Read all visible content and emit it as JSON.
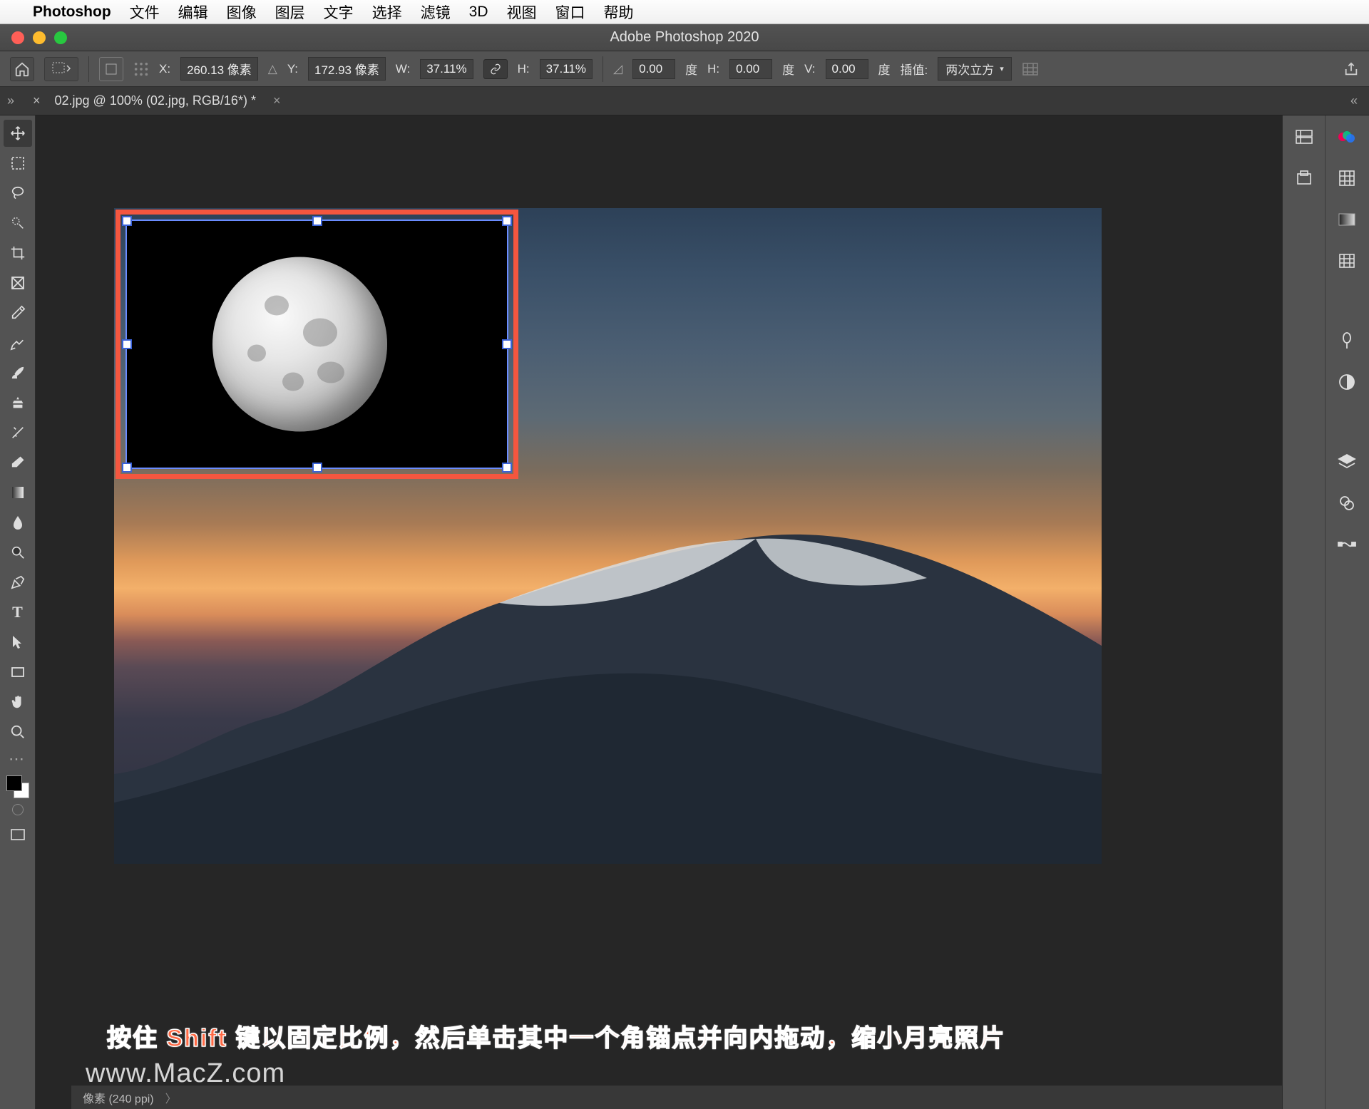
{
  "mac_menu": {
    "app": "Photoshop",
    "items": [
      "文件",
      "编辑",
      "图像",
      "图层",
      "文字",
      "选择",
      "滤镜",
      "3D",
      "视图",
      "窗口",
      "帮助"
    ]
  },
  "window": {
    "title": "Adobe Photoshop 2020"
  },
  "options_bar": {
    "x_label": "X:",
    "x_value": "260.13 像素",
    "y_label": "Y:",
    "y_value": "172.93 像素",
    "w_label": "W:",
    "w_value": "37.11%",
    "h_label": "H:",
    "h_value": "37.11%",
    "angle_value": "0.00",
    "angle_unit": "度",
    "hskew_label": "H:",
    "hskew_value": "0.00",
    "hskew_unit": "度",
    "vskew_label": "V:",
    "vskew_value": "0.00",
    "vskew_unit": "度",
    "interp_label": "插值:",
    "interp_value": "两次立方"
  },
  "tab": {
    "name": "02.jpg @ 100% (02.jpg, RGB/16*) *"
  },
  "status": {
    "dims_text": "像素 (240 ppi)"
  },
  "instruction": "按住 Shift 键以固定比例，然后单击其中一个角锚点并向内拖动，缩小月亮照片",
  "watermark": "www.MacZ.com"
}
